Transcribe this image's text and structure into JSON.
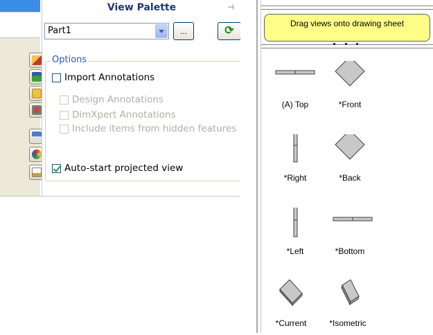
{
  "panel": {
    "title": "View Palette",
    "part_value": "Part1",
    "browse_label": "...",
    "refresh_label": "⟳",
    "options_legend": "Options",
    "options": {
      "import_annotations": "Import Annotations",
      "design_annotations": "Design Annotations",
      "dimxpert_annotations": "DimXpert Annotations",
      "hidden_features": "Include items from hidden features",
      "auto_start": "Auto-start projected view"
    }
  },
  "palette": {
    "hint": "Drag views onto drawing sheet",
    "views": [
      {
        "label": "(A) Top",
        "shape": "flat-horizontal-bar"
      },
      {
        "label": "*Front",
        "shape": "diamond"
      },
      {
        "label": "*Right",
        "shape": "vertical-bar"
      },
      {
        "label": "*Back",
        "shape": "diamond"
      },
      {
        "label": "*Left",
        "shape": "vertical-bar"
      },
      {
        "label": "*Bottom",
        "shape": "flat-horizontal-bar"
      },
      {
        "label": "*Current",
        "shape": "isometric-plate"
      },
      {
        "label": "*Isometric",
        "shape": "isometric-tilted"
      }
    ]
  },
  "colors": {
    "accent_blue": "#3a8ee6",
    "hint_yellow": "#ffff88",
    "title_blue": "#1e3870",
    "check_green": "#21a121"
  }
}
